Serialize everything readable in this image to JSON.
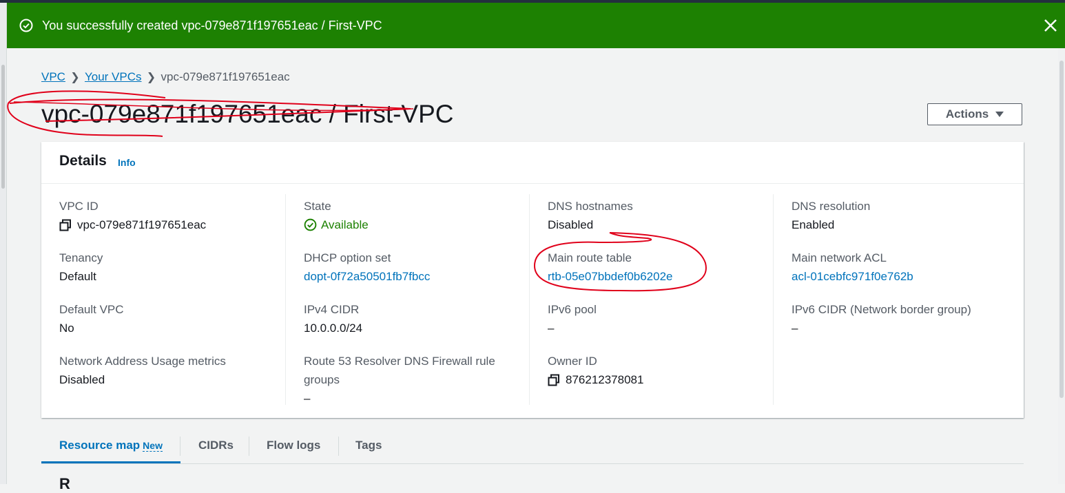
{
  "flash": {
    "message": "You successfully created vpc-079e871f197651eac / First-VPC",
    "icon": "check-circle-icon",
    "close_icon": "close-icon",
    "color": "#1d8102"
  },
  "breadcrumb": {
    "items": [
      "VPC",
      "Your VPCs",
      "vpc-079e871f197651eac"
    ]
  },
  "page_title": "vpc-079e871f197651eac / First-VPC",
  "actions_label": "Actions",
  "details": {
    "title": "Details",
    "info": "Info",
    "vpc_id": {
      "label": "VPC ID",
      "value": "vpc-079e871f197651eac"
    },
    "tenancy": {
      "label": "Tenancy",
      "value": "Default"
    },
    "default_vpc": {
      "label": "Default VPC",
      "value": "No"
    },
    "nau_metrics": {
      "label": "Network Address Usage metrics",
      "value": "Disabled"
    },
    "state": {
      "label": "State",
      "value": "Available"
    },
    "dhcp": {
      "label": "DHCP option set",
      "value": "dopt-0f72a50501fb7fbcc"
    },
    "ipv4_cidr": {
      "label": "IPv4 CIDR",
      "value": "10.0.0.0/24"
    },
    "r53": {
      "label": "Route 53 Resolver DNS Firewall rule groups",
      "value": "–"
    },
    "dns_hostnames": {
      "label": "DNS hostnames",
      "value": "Disabled"
    },
    "main_route_table": {
      "label": "Main route table",
      "value": "rtb-05e07bbdef0b6202e"
    },
    "ipv6_pool": {
      "label": "IPv6 pool",
      "value": "–"
    },
    "owner_id": {
      "label": "Owner ID",
      "value": "876212378081"
    },
    "dns_resolution": {
      "label": "DNS resolution",
      "value": "Enabled"
    },
    "main_acl": {
      "label": "Main network ACL",
      "value": "acl-01cebfc971f0e762b"
    },
    "ipv6_cidr": {
      "label": "IPv6 CIDR (Network border group)",
      "value": "–"
    }
  },
  "tabs": [
    {
      "label": "Resource map",
      "badge": "New"
    },
    {
      "label": "CIDRs"
    },
    {
      "label": "Flow logs"
    },
    {
      "label": "Tags"
    }
  ],
  "colors": {
    "link": "#0073bb",
    "success": "#1d8102",
    "annotation": "#e0001a"
  }
}
